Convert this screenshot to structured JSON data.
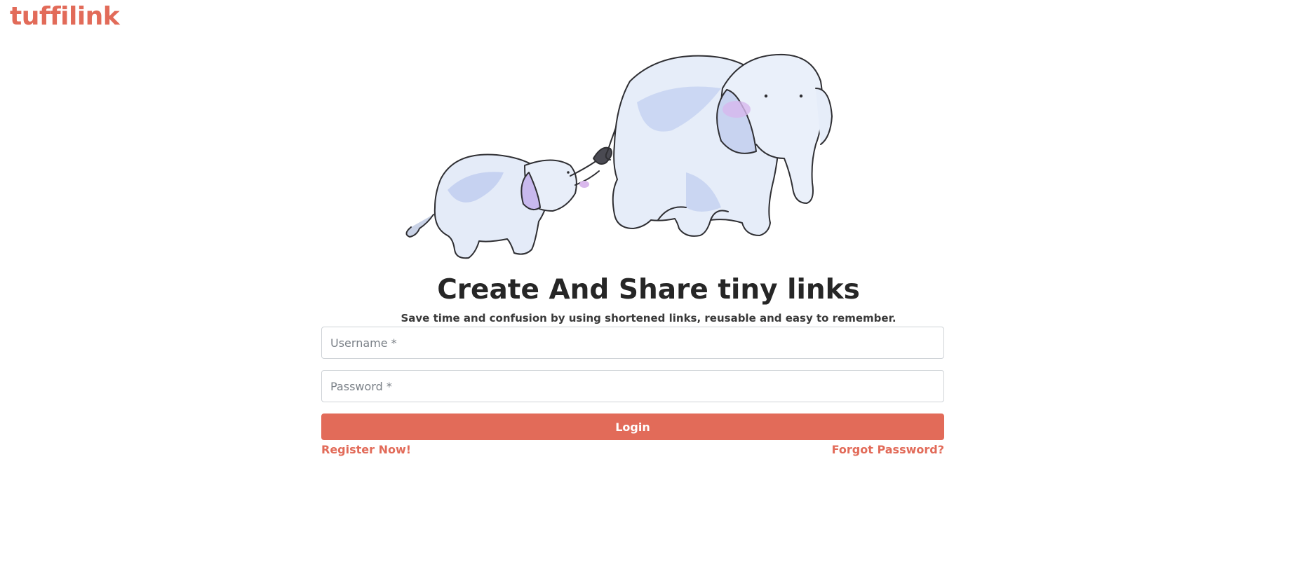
{
  "brand": {
    "name": "tuffilink",
    "color": "#e26b59"
  },
  "hero": {
    "illustration": "elephants-illustration"
  },
  "main": {
    "title": "Create And Share tiny links",
    "subtitle": "Save time and confusion by using shortened links, reusable and easy to remember."
  },
  "form": {
    "username_placeholder": "Username *",
    "password_placeholder": "Password *",
    "login_label": "Login",
    "register_label": "Register Now!",
    "forgot_label": "Forgot Password?"
  },
  "colors": {
    "accent": "#e26b59",
    "elephant_fill": "#dfe8f7",
    "elephant_shade": "#a9bcea",
    "cheek": "#d6b6ec"
  }
}
